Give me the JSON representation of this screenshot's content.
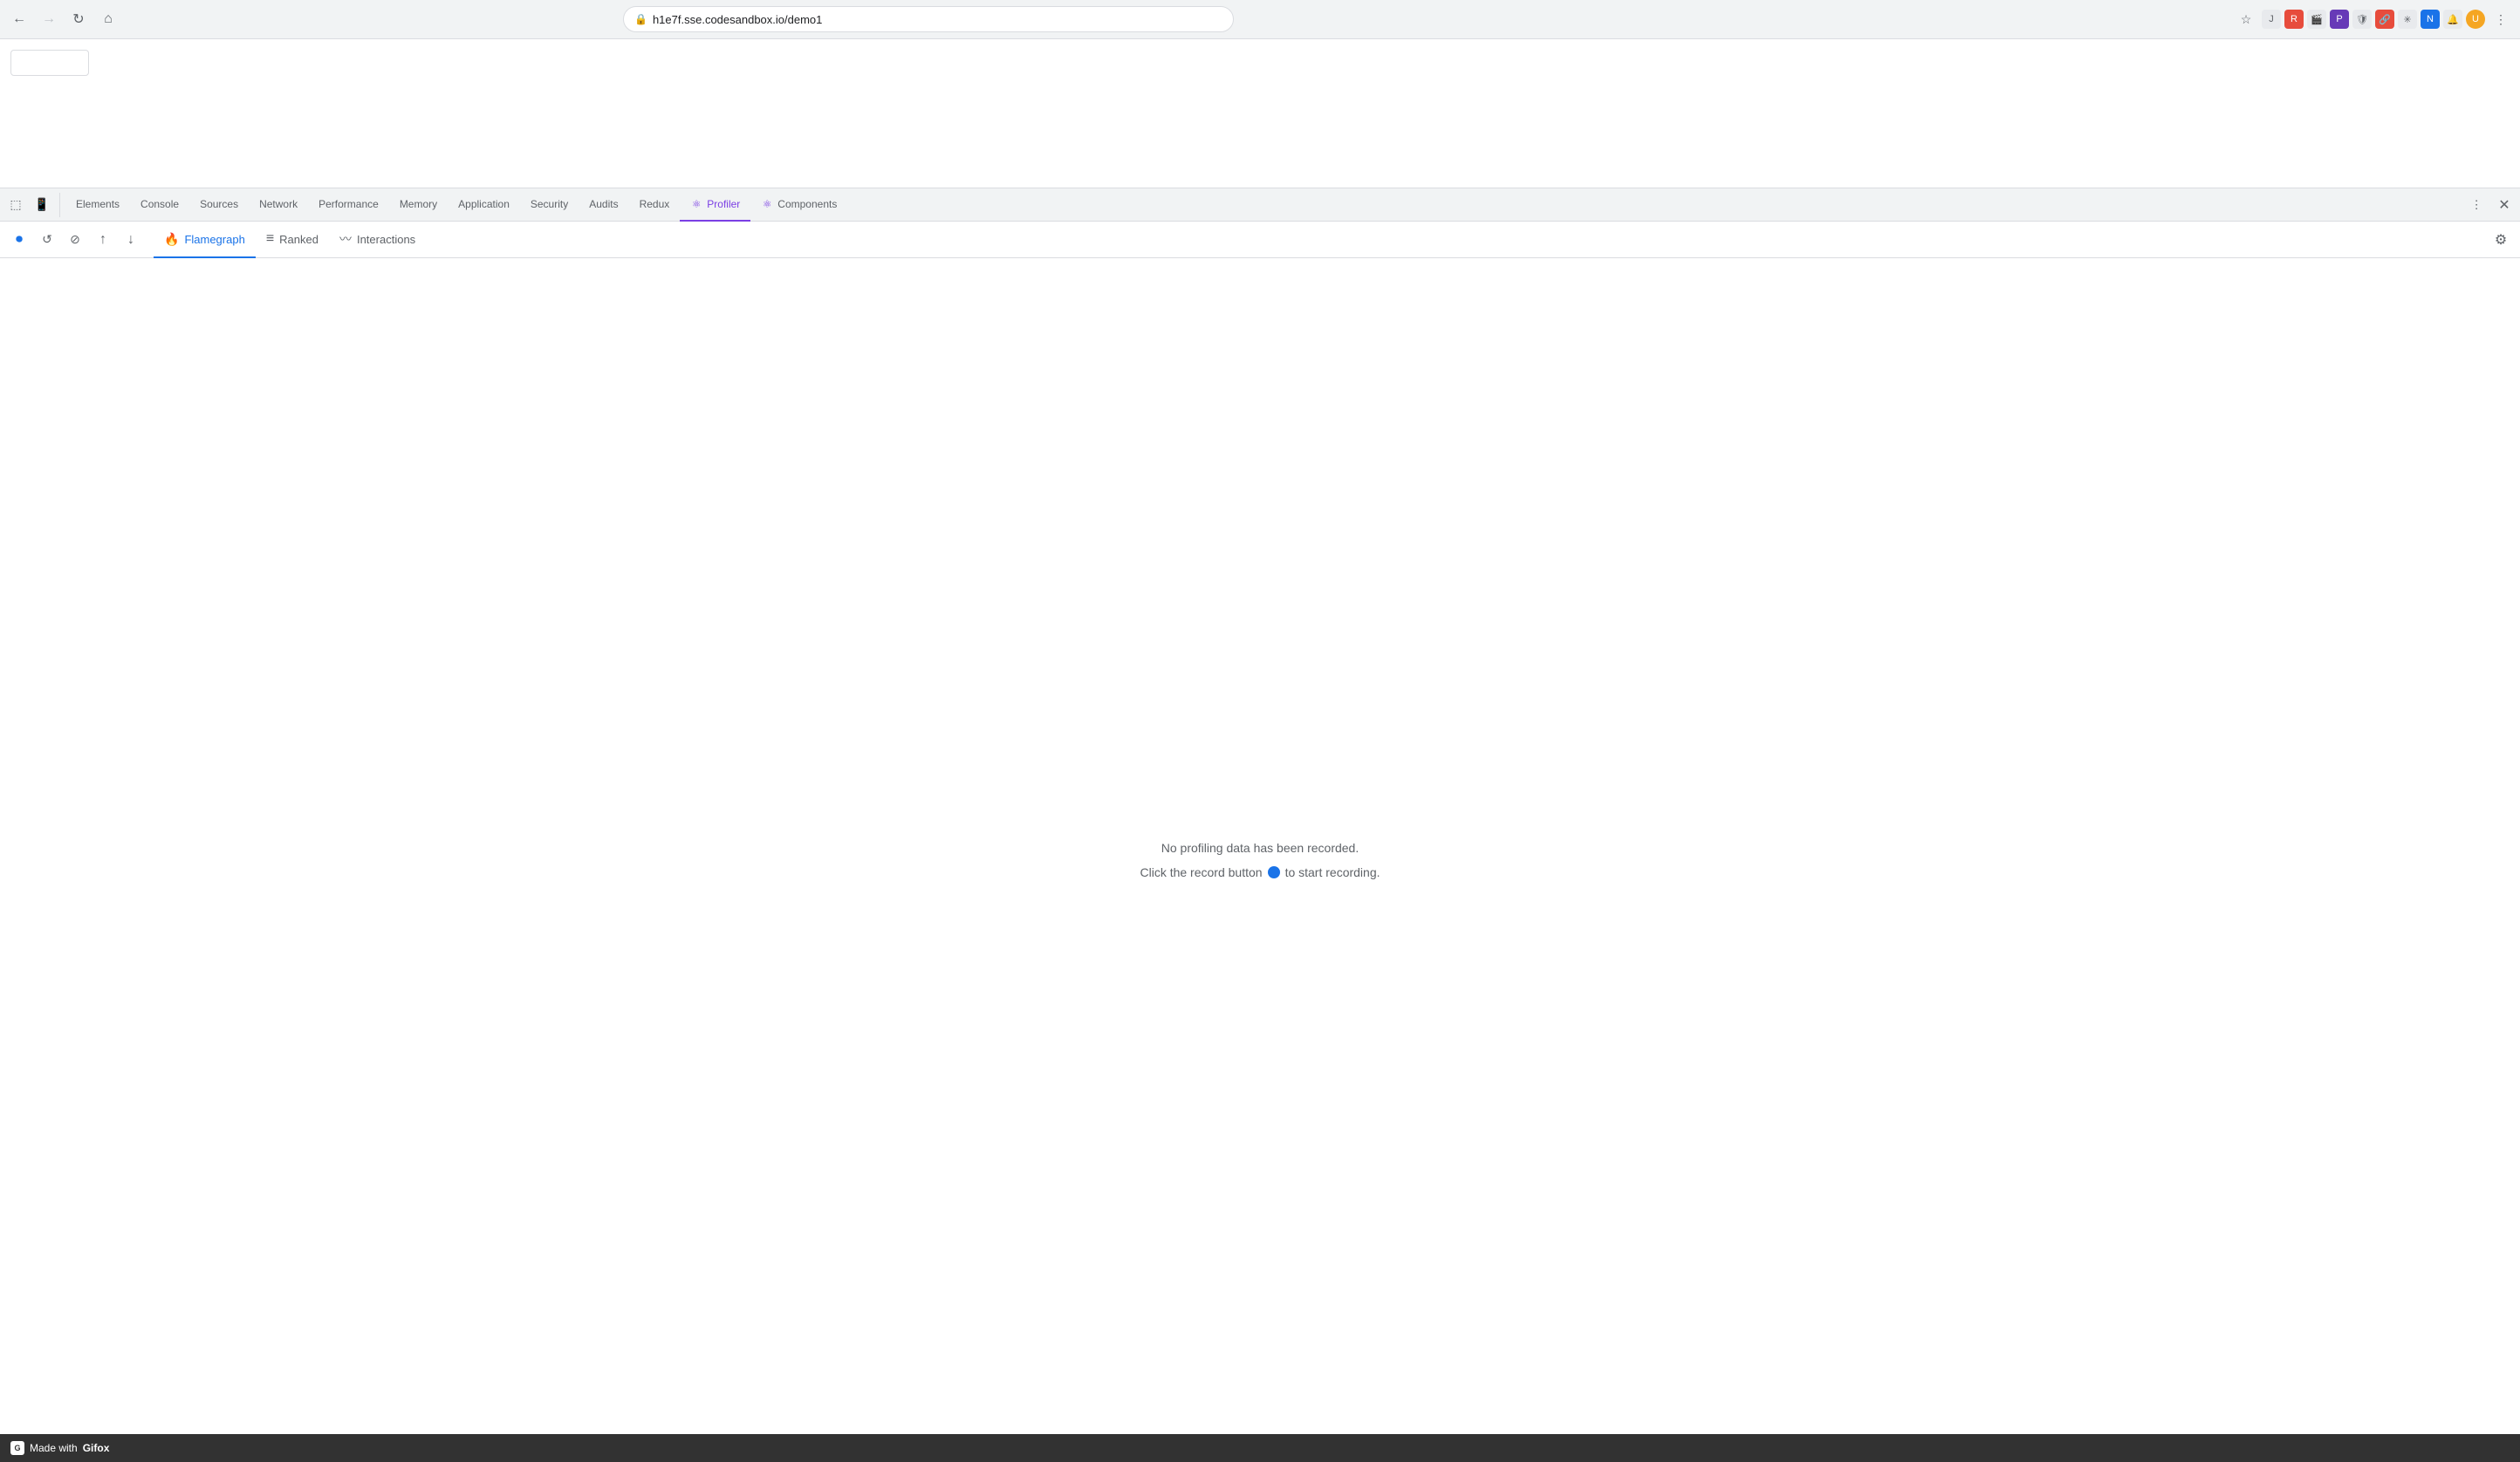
{
  "browser": {
    "url": "h1e7f.sse.codesandbox.io/demo1",
    "back_disabled": false,
    "forward_disabled": true
  },
  "devtools": {
    "tabs": [
      {
        "id": "elements",
        "label": "Elements",
        "active": false
      },
      {
        "id": "console",
        "label": "Console",
        "active": false
      },
      {
        "id": "sources",
        "label": "Sources",
        "active": false
      },
      {
        "id": "network",
        "label": "Network",
        "active": false
      },
      {
        "id": "performance",
        "label": "Performance",
        "active": false
      },
      {
        "id": "memory",
        "label": "Memory",
        "active": false
      },
      {
        "id": "application",
        "label": "Application",
        "active": false
      },
      {
        "id": "security",
        "label": "Security",
        "active": false
      },
      {
        "id": "audits",
        "label": "Audits",
        "active": false
      },
      {
        "id": "redux",
        "label": "Redux",
        "active": false
      },
      {
        "id": "profiler",
        "label": "Profiler",
        "active": true,
        "icon": "⚛",
        "color": "purple"
      },
      {
        "id": "components",
        "label": "Components",
        "active": false,
        "icon": "⚛",
        "color": "purple"
      }
    ]
  },
  "profiler": {
    "subtabs": [
      {
        "id": "flamegraph",
        "label": "Flamegraph",
        "active": true,
        "icon": "🔥"
      },
      {
        "id": "ranked",
        "label": "Ranked",
        "active": false,
        "icon": "≡"
      },
      {
        "id": "interactions",
        "label": "Interactions",
        "active": false,
        "icon": "〰"
      }
    ],
    "no_data_message": "No profiling data has been recorded.",
    "record_hint_before": "Click the record button",
    "record_hint_after": "to start recording."
  },
  "bottom_bar": {
    "made_with": "Made with",
    "brand": "Gifox"
  }
}
